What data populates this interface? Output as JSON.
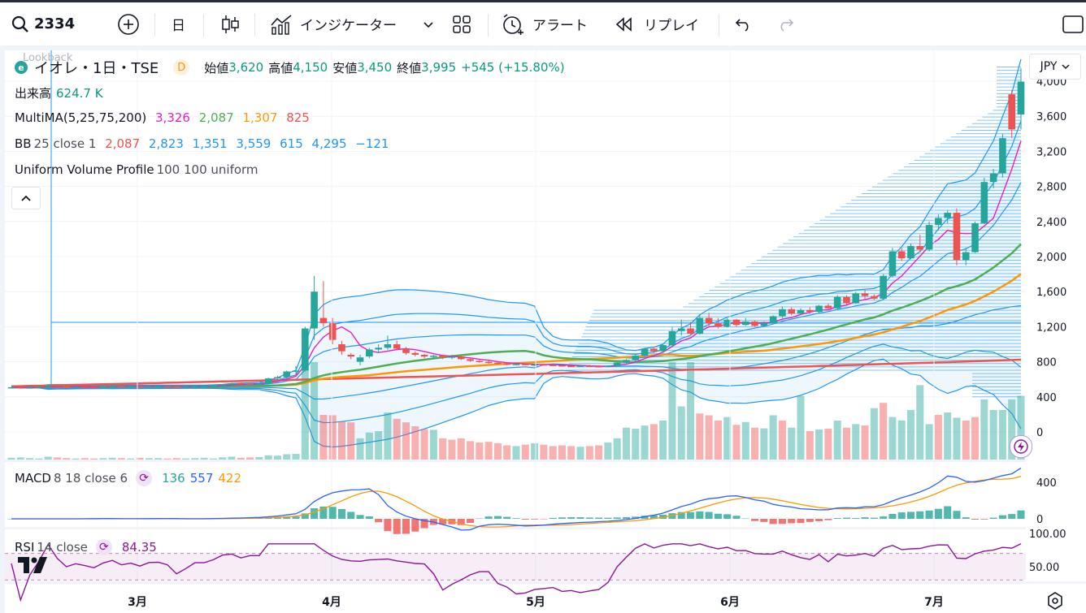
{
  "toolbar": {
    "symbol": "2334",
    "interval": "日",
    "indicators_label": "インジケーター",
    "alert_label": "アラート",
    "replay_label": "リプレイ"
  },
  "legend": {
    "logo_letter": "e",
    "title": "イオレ・1日・TSE",
    "badge": "D",
    "overlay_text": "Lookback",
    "open_label": "始値",
    "open": "3,620",
    "high_label": "高値",
    "high": "4,150",
    "low_label": "安値",
    "low": "3,450",
    "close_label": "終値",
    "close": "3,995",
    "change": "+545 (+15.80%)",
    "volume_label": "出来高",
    "volume": "624.7 K",
    "ma_label": "MultiMA(5,25,75,200)",
    "ma_values": [
      "3,326",
      "2,087",
      "1,307",
      "825"
    ],
    "bb_label": "BB",
    "bb_params": "25 close 1",
    "bb_values": [
      "2,087",
      "2,823",
      "1,351",
      "3,559",
      "615",
      "4,295",
      "−121"
    ],
    "vp_label": "Uniform Volume Profile",
    "vp_params": "100 100 uniform",
    "macd_label": "MACD",
    "macd_params": "8 18 close 6",
    "macd_values": [
      "136",
      "557",
      "422"
    ],
    "rsi_label": "RSI",
    "rsi_params": "14 close",
    "rsi_value": "84.35"
  },
  "currency": "JPY",
  "colors": {
    "up": "#26a69a",
    "down": "#ef5350",
    "ma5": "#e91ec7",
    "ma25": "#4caf50",
    "ma75": "#ff9800",
    "ma200": "#f05350",
    "bb": "#2196f3",
    "macd": "#2962ff",
    "signal": "#ff9800",
    "rsi": "#8e1599"
  },
  "chart_data": [
    {
      "type": "candlestick",
      "title": "イオレ・1日・TSE",
      "ylim": [
        -150,
        4150
      ],
      "y_ticks": [
        "4,000",
        "3,600",
        "3,200",
        "2,800",
        "2,400",
        "2,000",
        "1,600",
        "1,200",
        "800",
        "400",
        "0"
      ],
      "x_ticks": [
        "3月",
        "4月",
        "5月",
        "6月",
        "7月"
      ],
      "candles": [
        [
          505,
          515,
          495,
          510
        ],
        [
          510,
          520,
          500,
          505
        ],
        [
          505,
          512,
          498,
          508
        ],
        [
          508,
          515,
          500,
          512
        ],
        [
          512,
          540,
          505,
          530
        ],
        [
          530,
          535,
          515,
          520
        ],
        [
          520,
          525,
          500,
          510
        ],
        [
          510,
          520,
          505,
          515
        ],
        [
          515,
          525,
          505,
          512
        ],
        [
          512,
          520,
          500,
          508
        ],
        [
          508,
          520,
          505,
          518
        ],
        [
          518,
          530,
          510,
          525
        ],
        [
          525,
          530,
          510,
          515
        ],
        [
          515,
          525,
          505,
          520
        ],
        [
          520,
          528,
          510,
          512
        ],
        [
          512,
          520,
          505,
          518
        ],
        [
          518,
          525,
          510,
          522
        ],
        [
          522,
          530,
          515,
          518
        ],
        [
          518,
          525,
          505,
          510
        ],
        [
          510,
          520,
          500,
          515
        ],
        [
          515,
          525,
          505,
          520
        ],
        [
          520,
          530,
          515,
          525
        ],
        [
          525,
          535,
          520,
          530
        ],
        [
          530,
          545,
          520,
          540
        ],
        [
          540,
          560,
          530,
          555
        ],
        [
          555,
          565,
          540,
          550
        ],
        [
          550,
          560,
          535,
          545
        ],
        [
          545,
          555,
          530,
          550
        ],
        [
          550,
          620,
          540,
          610
        ],
        [
          610,
          640,
          590,
          625
        ],
        [
          625,
          700,
          610,
          690
        ],
        [
          690,
          750,
          650,
          700
        ],
        [
          700,
          1200,
          690,
          1180
        ],
        [
          1180,
          1780,
          1050,
          1600
        ],
        [
          1300,
          1720,
          1200,
          1240
        ],
        [
          1240,
          1300,
          1000,
          1050
        ],
        [
          1000,
          1040,
          880,
          920
        ],
        [
          880,
          900,
          830,
          860
        ],
        [
          800,
          880,
          760,
          850
        ],
        [
          860,
          960,
          840,
          940
        ],
        [
          940,
          1000,
          900,
          960
        ],
        [
          960,
          1100,
          940,
          1000
        ],
        [
          1000,
          1040,
          930,
          950
        ],
        [
          950,
          970,
          880,
          900
        ],
        [
          900,
          920,
          860,
          880
        ],
        [
          880,
          890,
          840,
          860
        ],
        [
          860,
          880,
          830,
          870
        ],
        [
          870,
          880,
          830,
          850
        ],
        [
          850,
          880,
          830,
          860
        ],
        [
          860,
          870,
          820,
          830
        ],
        [
          830,
          840,
          800,
          810
        ],
        [
          810,
          820,
          790,
          800
        ],
        [
          800,
          810,
          780,
          790
        ],
        [
          790,
          800,
          770,
          780
        ],
        [
          780,
          790,
          760,
          770
        ],
        [
          770,
          780,
          760,
          775
        ],
        [
          775,
          785,
          760,
          765
        ],
        [
          765,
          775,
          750,
          770
        ],
        [
          770,
          780,
          760,
          765
        ],
        [
          765,
          775,
          750,
          760
        ],
        [
          760,
          770,
          745,
          755
        ],
        [
          755,
          760,
          740,
          750
        ],
        [
          750,
          760,
          740,
          755
        ],
        [
          755,
          765,
          745,
          750
        ],
        [
          750,
          760,
          735,
          745
        ],
        [
          745,
          760,
          740,
          755
        ],
        [
          755,
          800,
          750,
          790
        ],
        [
          790,
          830,
          780,
          820
        ],
        [
          820,
          880,
          800,
          870
        ],
        [
          870,
          960,
          860,
          950
        ],
        [
          950,
          960,
          900,
          920
        ],
        [
          920,
          1000,
          910,
          990
        ],
        [
          990,
          1200,
          980,
          1150
        ],
        [
          1150,
          1280,
          1100,
          1180
        ],
        [
          1180,
          1250,
          1100,
          1120
        ],
        [
          1120,
          1340,
          1110,
          1300
        ],
        [
          1300,
          1360,
          1200,
          1240
        ],
        [
          1240,
          1300,
          1180,
          1200
        ],
        [
          1200,
          1300,
          1190,
          1280
        ],
        [
          1280,
          1290,
          1200,
          1220
        ],
        [
          1220,
          1300,
          1210,
          1260
        ],
        [
          1260,
          1270,
          1200,
          1210
        ],
        [
          1210,
          1260,
          1200,
          1240
        ],
        [
          1240,
          1330,
          1230,
          1320
        ],
        [
          1320,
          1430,
          1300,
          1400
        ],
        [
          1400,
          1420,
          1330,
          1350
        ],
        [
          1350,
          1410,
          1340,
          1390
        ],
        [
          1390,
          1420,
          1350,
          1370
        ],
        [
          1370,
          1450,
          1360,
          1440
        ],
        [
          1440,
          1460,
          1400,
          1410
        ],
        [
          1410,
          1560,
          1400,
          1540
        ],
        [
          1540,
          1560,
          1450,
          1470
        ],
        [
          1470,
          1600,
          1460,
          1580
        ],
        [
          1580,
          1620,
          1520,
          1550
        ],
        [
          1550,
          1570,
          1500,
          1520
        ],
        [
          1520,
          1800,
          1510,
          1780
        ],
        [
          1780,
          2100,
          1760,
          2060
        ],
        [
          2060,
          2100,
          1950,
          1980
        ],
        [
          1980,
          2150,
          1970,
          2120
        ],
        [
          2120,
          2250,
          2050,
          2080
        ],
        [
          2080,
          2400,
          2060,
          2360
        ],
        [
          2360,
          2480,
          2300,
          2440
        ],
        [
          2440,
          2530,
          2380,
          2500
        ],
        [
          2500,
          2550,
          1900,
          1960
        ],
        [
          1960,
          2100,
          1900,
          2050
        ],
        [
          2050,
          2400,
          2040,
          2380
        ],
        [
          2380,
          2900,
          2370,
          2850
        ],
        [
          2850,
          3000,
          2780,
          2950
        ],
        [
          2950,
          3400,
          2900,
          3350
        ],
        [
          3850,
          3900,
          3350,
          3450
        ],
        [
          3620,
          4150,
          3450,
          3995
        ]
      ],
      "volume_thousands": [
        [
          50,
          1
        ],
        [
          60,
          1
        ],
        [
          40,
          1
        ],
        [
          30,
          1
        ],
        [
          80,
          1
        ],
        [
          60,
          0
        ],
        [
          40,
          0
        ],
        [
          30,
          1
        ],
        [
          40,
          0
        ],
        [
          30,
          0
        ],
        [
          40,
          1
        ],
        [
          50,
          1
        ],
        [
          40,
          0
        ],
        [
          30,
          1
        ],
        [
          50,
          0
        ],
        [
          40,
          1
        ],
        [
          40,
          1
        ],
        [
          30,
          0
        ],
        [
          40,
          0
        ],
        [
          30,
          1
        ],
        [
          40,
          1
        ],
        [
          50,
          1
        ],
        [
          30,
          1
        ],
        [
          60,
          1
        ],
        [
          80,
          1
        ],
        [
          50,
          0
        ],
        [
          60,
          0
        ],
        [
          70,
          1
        ],
        [
          120,
          1
        ],
        [
          110,
          1
        ],
        [
          150,
          1
        ],
        [
          160,
          1
        ],
        [
          2750,
          1
        ],
        [
          2750,
          1
        ],
        [
          1260,
          0
        ],
        [
          1250,
          0
        ],
        [
          1070,
          0
        ],
        [
          1050,
          0
        ],
        [
          600,
          1
        ],
        [
          760,
          1
        ],
        [
          800,
          1
        ],
        [
          1330,
          1
        ],
        [
          1150,
          0
        ],
        [
          1050,
          0
        ],
        [
          940,
          0
        ],
        [
          860,
          0
        ],
        [
          840,
          1
        ],
        [
          600,
          0
        ],
        [
          560,
          0
        ],
        [
          600,
          0
        ],
        [
          520,
          0
        ],
        [
          480,
          0
        ],
        [
          500,
          0
        ],
        [
          460,
          0
        ],
        [
          400,
          0
        ],
        [
          380,
          1
        ],
        [
          420,
          0
        ],
        [
          460,
          1
        ],
        [
          420,
          0
        ],
        [
          380,
          0
        ],
        [
          400,
          0
        ],
        [
          380,
          0
        ],
        [
          360,
          1
        ],
        [
          380,
          0
        ],
        [
          400,
          0
        ],
        [
          480,
          1
        ],
        [
          600,
          1
        ],
        [
          900,
          1
        ],
        [
          870,
          1
        ],
        [
          960,
          1
        ],
        [
          1000,
          0
        ],
        [
          1100,
          1
        ],
        [
          2750,
          1
        ],
        [
          1500,
          1
        ],
        [
          2750,
          1
        ],
        [
          1300,
          0
        ],
        [
          1250,
          0
        ],
        [
          1100,
          0
        ],
        [
          1200,
          1
        ],
        [
          980,
          0
        ],
        [
          1060,
          1
        ],
        [
          900,
          0
        ],
        [
          880,
          1
        ],
        [
          1250,
          1
        ],
        [
          1100,
          0
        ],
        [
          900,
          1
        ],
        [
          1800,
          1
        ],
        [
          800,
          0
        ],
        [
          850,
          1
        ],
        [
          870,
          0
        ],
        [
          1100,
          1
        ],
        [
          900,
          0
        ],
        [
          1000,
          1
        ],
        [
          960,
          0
        ],
        [
          1450,
          1
        ],
        [
          1600,
          0
        ],
        [
          1200,
          1
        ],
        [
          1100,
          1
        ],
        [
          1400,
          1
        ],
        [
          2100,
          1
        ],
        [
          1000,
          1
        ],
        [
          1260,
          0
        ],
        [
          1330,
          1
        ],
        [
          1180,
          1
        ],
        [
          1100,
          0
        ],
        [
          1200,
          0
        ],
        [
          1700,
          1
        ],
        [
          1400,
          1
        ],
        [
          1400,
          1
        ],
        [
          1700,
          1
        ],
        [
          1800,
          1
        ],
        [
          1800,
          0
        ],
        [
          2000,
          1
        ]
      ]
    },
    {
      "type": "line",
      "title": "MACD 8 18 close 6",
      "ylim": [
        -50,
        700
      ],
      "y_ticks": [
        "400",
        "0"
      ],
      "series": [
        {
          "name": "MACD",
          "values": [
            136
          ]
        },
        {
          "name": "Signal",
          "values": [
            422
          ]
        }
      ]
    },
    {
      "type": "line",
      "title": "RSI 14 close",
      "ylim": [
        0,
        120
      ],
      "y_ticks": [
        "100.00",
        "50.00"
      ],
      "series": [
        {
          "name": "RSI",
          "values": [
            84.35
          ]
        }
      ]
    }
  ]
}
